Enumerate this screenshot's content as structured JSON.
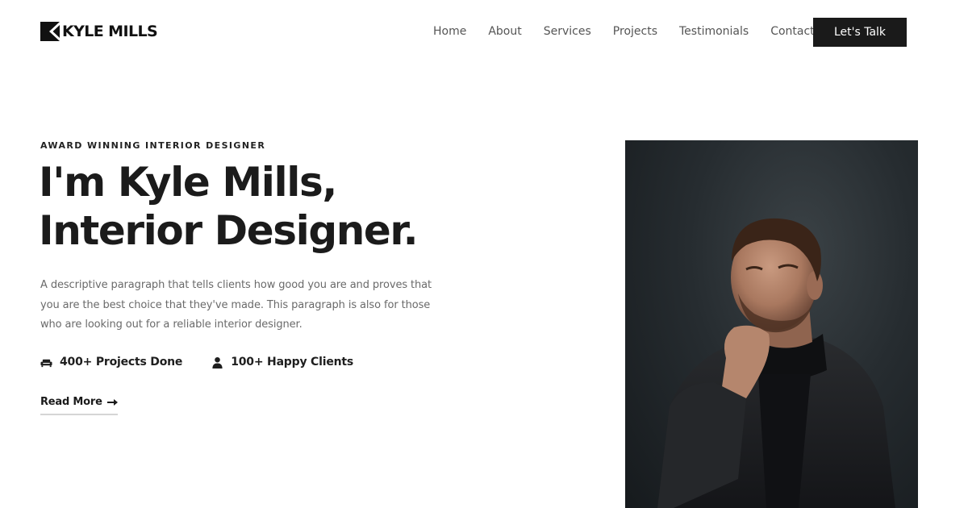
{
  "header": {
    "logo_text": "KYLE MILLS",
    "nav": [
      "Home",
      "About",
      "Services",
      "Projects",
      "Testimonials",
      "Contact"
    ],
    "cta_label": "Let's Talk"
  },
  "hero": {
    "eyebrow": "AWARD WINNING INTERIOR DESIGNER",
    "headline_line1": "I'm Kyle Mills,",
    "headline_line2": "Interior Designer.",
    "description": "A descriptive paragraph that tells clients how good you are and proves that you are the best choice that they've made. This paragraph is also for those who are looking out for a reliable interior designer.",
    "stats": [
      {
        "icon": "sofa-icon",
        "label": "400+ Projects Done"
      },
      {
        "icon": "user-icon",
        "label": "100+ Happy Clients"
      }
    ],
    "read_more_label": "Read More"
  },
  "colors": {
    "accent": "#1a1a1a",
    "text": "#1b1b1b",
    "muted": "#6a6a6a",
    "background": "#ffffff"
  }
}
